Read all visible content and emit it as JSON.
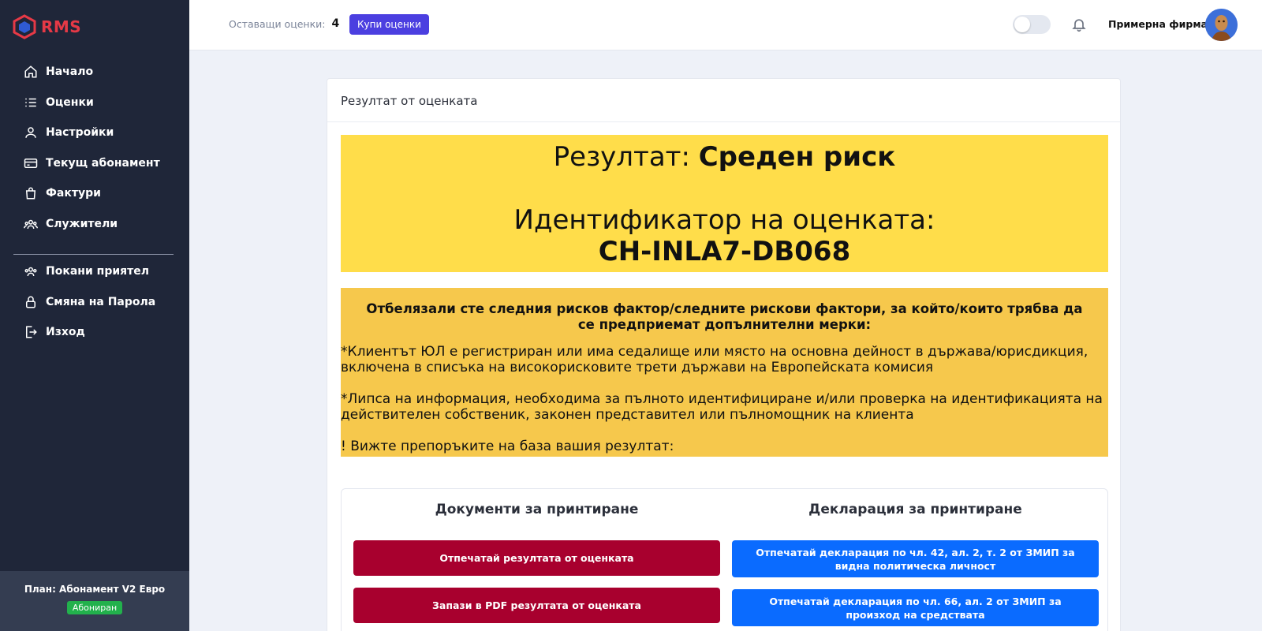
{
  "app": {
    "logo_text": "RMS"
  },
  "sidebar": {
    "items": [
      {
        "label": "Начало",
        "icon": "home-icon"
      },
      {
        "label": "Оценки",
        "icon": "list-icon"
      },
      {
        "label": "Настройки",
        "icon": "user-icon"
      },
      {
        "label": "Текущ абонамент",
        "icon": "credit-card-icon"
      },
      {
        "label": "Фактури",
        "icon": "shopping-bag-icon"
      },
      {
        "label": "Служители",
        "icon": "users-icon"
      }
    ],
    "secondary_items": [
      {
        "label": "Покани приятел",
        "icon": "users-icon"
      },
      {
        "label": "Смяна на Парола",
        "icon": "lock-icon"
      },
      {
        "label": "Изход",
        "icon": "logout-icon"
      }
    ],
    "plan": {
      "title": "План: Абонамент V2 Евро",
      "status": "Абониран"
    }
  },
  "header": {
    "remaining_label": "Оставащи оценки:",
    "remaining_count": "4",
    "buy_button": "Купи оценки",
    "company_name": "Примерна фирма"
  },
  "main": {
    "card_title": "Резултат от оценката",
    "result_prefix": "Резултат:",
    "result_value": "Среден риск",
    "id_label": "Идентификатор на оценката:",
    "id_value": "CH-INLA7-DB068",
    "risk_title": "Отбелязали сте следния рисков фактор/следните рискови фактори, за който/които трябва да се предприемат допълнителни мерки:",
    "risk_factors": [
      "*Клиентът ЮЛ е регистриран или има седалище или място на основна дейност в държава/юрисдикция, включена в списъка на високорисковите трети държави на Европейската комисия",
      "*Липса на информация, необходима за пълното идентифициране и/или проверка на идентификацията на действителен собственик, законен представител или пълномощник на клиента"
    ],
    "recommendation_note": "! Вижте препоръките на база вашия резултат:",
    "documents_title": "Документи за принтиране",
    "declaration_title": "Декларация за принтиране",
    "print_result_button": "Отпечатай резултата от оценката",
    "save_pdf_button": "Запази в PDF резултата от оценката",
    "print_decl_pep_button": "Отпечатай декларация по чл. 42, ал. 2, т. 2 от ЗМИП за видна политическа личност",
    "print_decl_funds_button": "Отпечатай декларация по чл. 66, ал. 2 от ЗМИП за произход на средствата"
  },
  "colors": {
    "sidebar_bg": "#1f2639",
    "accent": "#4b3fe0",
    "result_bg": "#ffdd4a",
    "risk_bg": "#f6c84c",
    "red_button": "#a8002e",
    "blue_button": "#0a6bff",
    "badge_green": "#22b14c"
  }
}
